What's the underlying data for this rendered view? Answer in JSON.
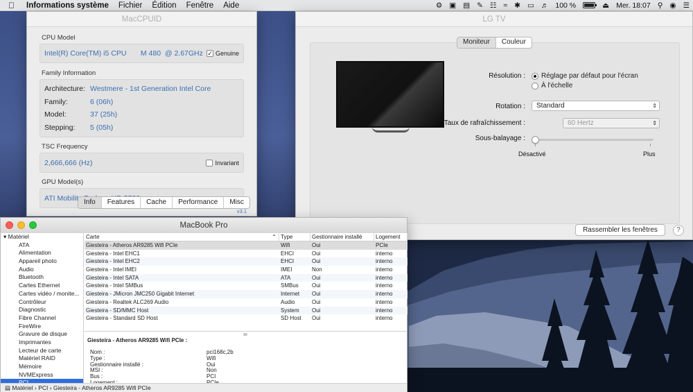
{
  "menubar": {
    "apple_icon": "apple-icon",
    "app_name": "Informations système",
    "menus": [
      "Fichier",
      "Édition",
      "Fenêtre",
      "Aide"
    ],
    "status": {
      "battery_percent": "100 %",
      "battery_level": 1.0,
      "clock": "Mer. 18:07"
    }
  },
  "maccpuid": {
    "title": "MacCPUID",
    "cpu_model_label": "CPU Model",
    "cpu_model_value": "Intel(R) Core(TM) i5 CPU       M 480  @ 2.67GHz",
    "genuine_label": "Genuine",
    "genuine_checked": true,
    "family_info_label": "Family Information",
    "family_rows": [
      {
        "key": "Architecture:",
        "value": "Westmere - 1st Generation Intel Core"
      },
      {
        "key": "Family:",
        "value": "6 (06h)"
      },
      {
        "key": "Model:",
        "value": "37 (25h)"
      },
      {
        "key": "Stepping:",
        "value": "5 (05h)"
      }
    ],
    "tsc_label": "TSC Frequency",
    "tsc_value": "2,666,666 (Hz)",
    "invariant_label": "Invariant",
    "invariant_checked": false,
    "gpu_label": "GPU Model(s)",
    "gpu_value": "ATI Mobility Radeon HD 5730",
    "tabs": [
      "Info",
      "Features",
      "Cache",
      "Performance",
      "Misc"
    ],
    "selected_tab": "Info",
    "version": "v3.1"
  },
  "lgtv": {
    "title": "LG TV",
    "tabs": [
      "Moniteur",
      "Couleur"
    ],
    "selected_tab": "Moniteur",
    "resolution_label": "Résolution :",
    "resolution_options": [
      "Réglage par défaut pour l'écran",
      "À l'échelle"
    ],
    "resolution_selected": 0,
    "rotation_label": "Rotation :",
    "rotation_value": "Standard",
    "refresh_label": "Taux de rafraîchissement :",
    "refresh_value": "60 Hertz",
    "underscan_label": "Sous-balayage :",
    "underscan_min": "Désactivé",
    "underscan_max": "Plus",
    "underscan_level": 0.0,
    "gather_button": "Rassembler les fenêtres",
    "help_glyph": "?"
  },
  "sysinfo": {
    "title": "MacBook Pro",
    "sidebar": {
      "header": "Matériel",
      "items": [
        "ATA",
        "Alimentation",
        "Appareil photo",
        "Audio",
        "Bluetooth",
        "Cartes Ethernet",
        "Cartes vidéo / monite...",
        "Contrôleur",
        "Diagnostic",
        "Fibre Channel",
        "FireWire",
        "Gravure de disque",
        "Imprimantes",
        "Lecteur de carte",
        "Matériel RAID",
        "Mémoire",
        "NVMExpress",
        "PCI"
      ],
      "selected": "PCI"
    },
    "table": {
      "columns": [
        "Carte",
        "Type",
        "Gestionnaire installé",
        "Logement"
      ],
      "rows": [
        [
          "Giesteira - Atheros AR9285 Wifi PCIe",
          "Wifi",
          "Oui",
          "PCIe"
        ],
        [
          "Giesteira - Intel EHC1",
          "EHCI",
          "Oui",
          "interno"
        ],
        [
          "Giesteira - Intel EHC2",
          "EHCI",
          "Oui",
          "interno"
        ],
        [
          "Giesteira - Intel IMEI",
          "IMEI",
          "Non",
          "interno"
        ],
        [
          "Giesteira - Intel SATA",
          "ATA",
          "Oui",
          "interno"
        ],
        [
          "Giesteira - Intel SMBus",
          "SMBus",
          "Oui",
          "interno"
        ],
        [
          "Giesteira - JMicron JMC250 Gigabit Internet",
          "Internet",
          "Oui",
          "interno"
        ],
        [
          "Giesteira - Realtek ALC269 Audio",
          "Audio",
          "Oui",
          "interno"
        ],
        [
          "Giesteira - SD/MMC Host",
          "System",
          "Oui",
          "interno"
        ],
        [
          "Giesteira - Standard SD Host",
          "SD Host",
          "Oui",
          "interno"
        ]
      ],
      "selected_row": 0
    },
    "detail": {
      "title": "Giesteira - Atheros AR9285 Wifi PCIe :",
      "rows": [
        {
          "k": "Nom :",
          "v": "pci168c,2b"
        },
        {
          "k": "Type :",
          "v": "Wifi"
        },
        {
          "k": "Gestionnaire installé :",
          "v": "Oui"
        },
        {
          "k": "MSI :",
          "v": "Non"
        },
        {
          "k": "Bus :",
          "v": "PCI"
        },
        {
          "k": "Logement :",
          "v": "PCIe"
        }
      ]
    },
    "pathbar": "Matériel  ›  PCI  ›  Giesteira - Atheros AR9285 Wifi PCIe"
  }
}
